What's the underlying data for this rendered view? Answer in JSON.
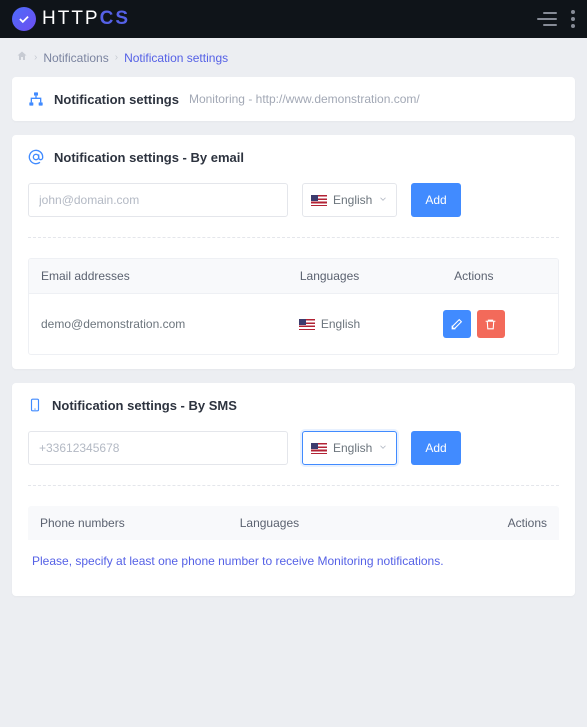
{
  "logo": {
    "text_a": "HTTP",
    "text_b": "CS"
  },
  "breadcrumb": {
    "item1": "Notifications",
    "item2": "Notification settings"
  },
  "page_header": {
    "title": "Notification settings",
    "subtitle": "Monitoring - http://www.demonstration.com/"
  },
  "email_section": {
    "title": "Notification settings - By email",
    "input_placeholder": "john@domain.com",
    "select_label": "English",
    "add_button": "Add",
    "table": {
      "col_email": "Email addresses",
      "col_lang": "Languages",
      "col_actions": "Actions",
      "rows": [
        {
          "email": "demo@demonstration.com",
          "language": "English"
        }
      ]
    }
  },
  "sms_section": {
    "title": "Notification settings - By SMS",
    "input_placeholder": "+33612345678",
    "select_label": "English",
    "add_button": "Add",
    "table": {
      "col_phone": "Phone numbers",
      "col_lang": "Languages",
      "col_actions": "Actions"
    },
    "empty_message": "Please, specify at least one phone number to receive Monitoring notifications."
  }
}
